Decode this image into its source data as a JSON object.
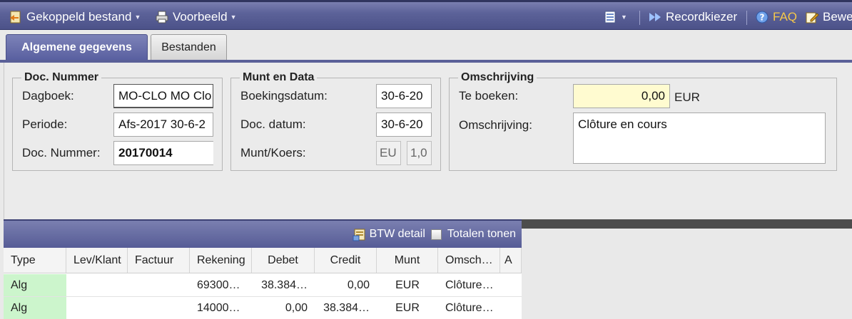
{
  "toolbar": {
    "linked_file_label": "Gekoppeld bestand",
    "preview_label": "Voorbeeld",
    "record_picker_label": "Recordkiezer",
    "faq_label": "FAQ",
    "edit_label": "Bewe"
  },
  "tabs": {
    "general_label": "Algemene gegevens",
    "files_label": "Bestanden"
  },
  "doc_group": {
    "legend": "Doc. Nummer",
    "journal_label": "Dagboek:",
    "journal_value": "MO-CLO MO Clo",
    "period_label": "Periode:",
    "period_value": "Afs-2017 30-6-2",
    "docnum_label": "Doc. Nummer:",
    "docnum_value": "20170014"
  },
  "currency_group": {
    "legend": "Munt en Data",
    "booking_date_label": "Boekingsdatum:",
    "booking_date_value": "30-6-20",
    "doc_date_label": "Doc. datum:",
    "doc_date_value": "30-6-20",
    "currency_rate_label": "Munt/Koers:",
    "currency_value": "EU",
    "rate_value": "1,0"
  },
  "description_group": {
    "legend": "Omschrijving",
    "to_book_label": "Te boeken:",
    "to_book_value": "0,00",
    "to_book_currency": "EUR",
    "description_label": "Omschrijving:",
    "description_value": "Clôture en cours"
  },
  "grid": {
    "vat_detail_label": "BTW detail",
    "show_totals_label": "Totalen tonen",
    "columns": [
      "Type",
      "Lev/Klant",
      "Factuur",
      "Rekening",
      "Debet",
      "Credit",
      "Munt",
      "Omsch…",
      "A"
    ],
    "rows": [
      [
        "Alg",
        "",
        "",
        "69300…",
        "38.384…",
        "0,00",
        "EUR",
        "Clôture…"
      ],
      [
        "Alg",
        "",
        "",
        "14000…",
        "0,00",
        "38.384…",
        "EUR",
        "Clôture…"
      ]
    ]
  },
  "colors": {
    "toolbar_bg": "#5c6299",
    "type_cell_bg": "#ccf5cc",
    "amount_field_bg": "#fffbd0",
    "faq_text": "#f6c84a"
  }
}
